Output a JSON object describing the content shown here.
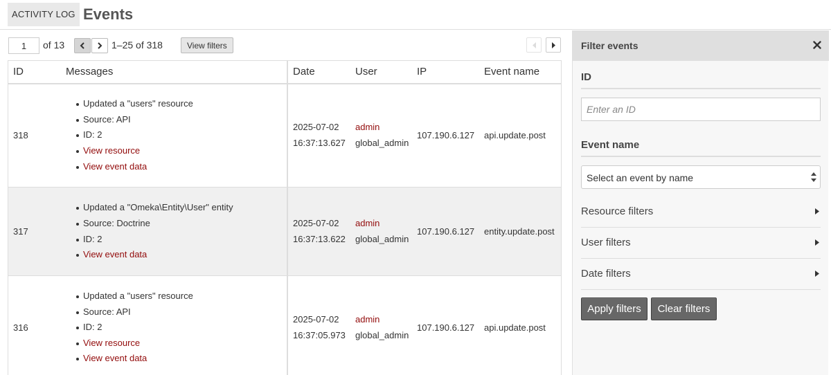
{
  "header": {
    "section": "ACTIVITY LOG",
    "title": "Events"
  },
  "pagination": {
    "page": "1",
    "of_label": "of 13",
    "range": "1–25 of 318",
    "view_filters_label": "View filters"
  },
  "table": {
    "columns": [
      "ID",
      "Messages",
      "Date",
      "User",
      "IP",
      "Event name"
    ],
    "rows": [
      {
        "id": "318",
        "messages": [
          "Updated a \"users\" resource",
          "Source: API",
          "ID: 2"
        ],
        "links": [
          "View resource",
          "View event data"
        ],
        "date": "2025-07-02",
        "time": "16:37:13.627",
        "user": "admin",
        "role": "global_admin",
        "ip": "107.190.6.127",
        "event": "api.update.post"
      },
      {
        "id": "317",
        "messages": [
          "Updated a \"Omeka\\Entity\\User\" entity",
          "Source: Doctrine",
          "ID: 2"
        ],
        "links": [
          "View event data"
        ],
        "date": "2025-07-02",
        "time": "16:37:13.622",
        "user": "admin",
        "role": "global_admin",
        "ip": "107.190.6.127",
        "event": "entity.update.post"
      },
      {
        "id": "316",
        "messages": [
          "Updated a \"users\" resource",
          "Source: API",
          "ID: 2"
        ],
        "links": [
          "View resource",
          "View event data"
        ],
        "date": "2025-07-02",
        "time": "16:37:05.973",
        "user": "admin",
        "role": "global_admin",
        "ip": "107.190.6.127",
        "event": "api.update.post"
      }
    ]
  },
  "filters": {
    "title": "Filter events",
    "id_label": "ID",
    "id_placeholder": "Enter an ID",
    "event_name_label": "Event name",
    "event_name_selected": "Select an event by name",
    "resource_filters": "Resource filters",
    "user_filters": "User filters",
    "date_filters": "Date filters",
    "apply_label": "Apply filters",
    "clear_label": "Clear filters"
  },
  "colors": {
    "link": "#920b0b",
    "button_dark": "#676767",
    "sidebar_header": "#dfdfdf"
  },
  "icons": [
    "chevron-left-icon",
    "chevron-right-icon",
    "close-icon",
    "select-arrows-icon",
    "caret-right-icon"
  ]
}
